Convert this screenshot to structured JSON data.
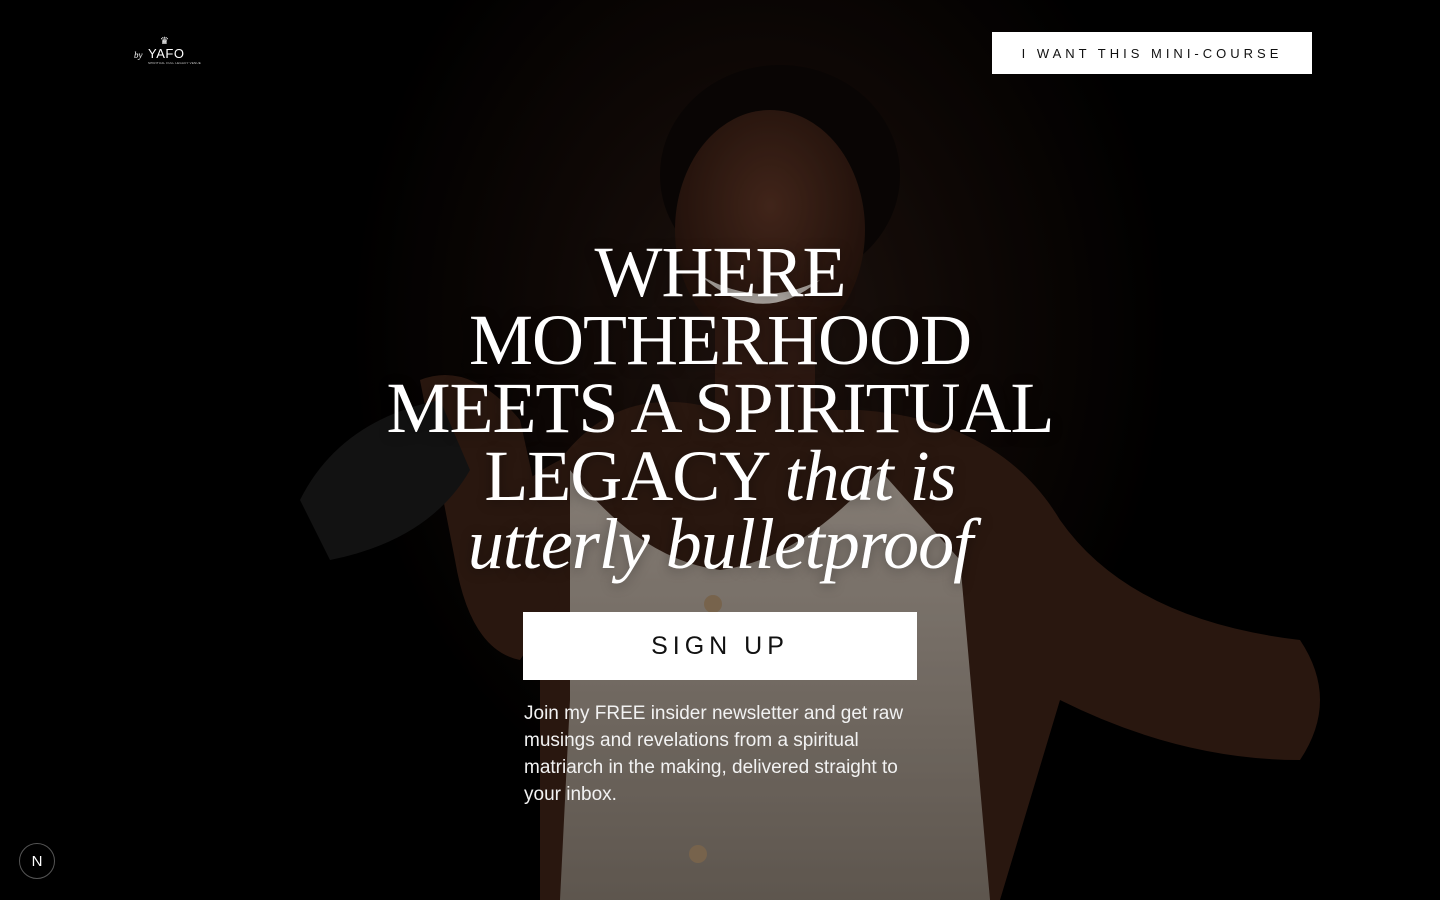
{
  "logo": {
    "by": "by",
    "mark": "YAFO",
    "crown": "♛",
    "tagline": "SPIRITUAL FULL LEGACY VENUE"
  },
  "header": {
    "cta_label": "I WANT THIS MINI-COURSE"
  },
  "hero": {
    "line1": "WHERE",
    "line2": "MOTHERHOOD",
    "line3": "MEETS A SPIRITUAL",
    "line4_roman": "LEGACY ",
    "line4_italic": "that is",
    "line5_italic": "utterly bulletproof"
  },
  "signup": {
    "label": "SIGN UP"
  },
  "blurb": {
    "text": "Join my FREE insider newsletter and get raw musings and revelations from a spiritual matriarch in the making, delivered straight to your inbox."
  },
  "badge": {
    "label": "N"
  }
}
